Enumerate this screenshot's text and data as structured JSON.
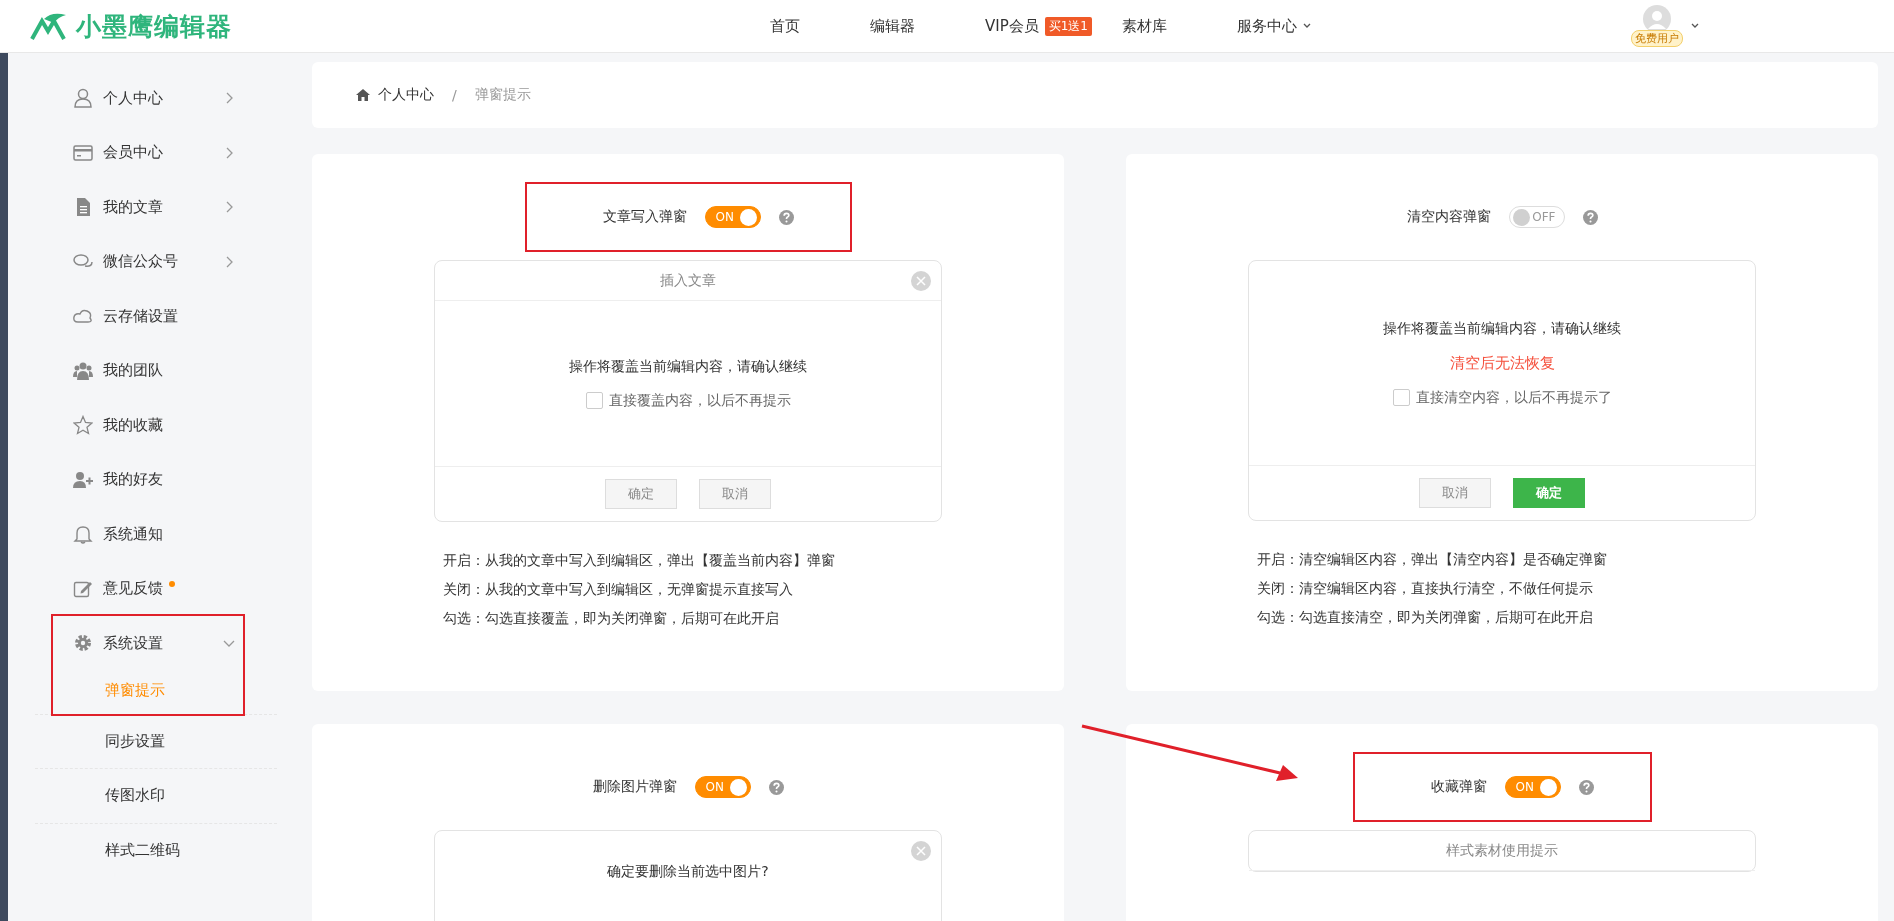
{
  "header": {
    "logo": "小墨鹰编辑器",
    "nav": [
      {
        "label": "首页",
        "dropdown": false
      },
      {
        "label": "编辑器",
        "dropdown": false
      },
      {
        "label": "VIP会员",
        "badge": "买1送1",
        "dropdown": false
      },
      {
        "label": "素材库",
        "dropdown": false
      },
      {
        "label": "服务中心",
        "dropdown": true
      }
    ],
    "user_badge": "免费用户"
  },
  "sidebar": {
    "items": [
      {
        "label": "个人中心",
        "kind": "group",
        "expanded": false,
        "unread": false,
        "highlighted": false
      },
      {
        "label": "会员中心",
        "kind": "group",
        "expanded": false,
        "unread": false,
        "highlighted": false
      },
      {
        "label": "我的文章",
        "kind": "group",
        "expanded": false,
        "unread": false,
        "highlighted": false
      },
      {
        "label": "微信公众号",
        "kind": "group",
        "expanded": false,
        "unread": false,
        "highlighted": false
      },
      {
        "label": "云存储设置",
        "kind": "link",
        "unread": false,
        "highlighted": false
      },
      {
        "label": "我的团队",
        "kind": "link",
        "unread": false,
        "highlighted": false
      },
      {
        "label": "我的收藏",
        "kind": "link",
        "unread": false,
        "highlighted": false
      },
      {
        "label": "我的好友",
        "kind": "link",
        "unread": false,
        "highlighted": false
      },
      {
        "label": "系统通知",
        "kind": "link",
        "unread": false,
        "highlighted": false
      },
      {
        "label": "意见反馈",
        "kind": "link",
        "unread": true,
        "highlighted": false
      },
      {
        "label": "系统设置",
        "kind": "group",
        "expanded": true,
        "unread": false,
        "highlighted": true,
        "children": [
          {
            "label": "弹窗提示",
            "selected": true
          },
          {
            "label": "同步设置",
            "selected": false
          },
          {
            "label": "传图水印",
            "selected": false
          },
          {
            "label": "样式二维码",
            "selected": false
          }
        ]
      }
    ]
  },
  "breadcrumb": {
    "separator": "/",
    "items": [
      "个人中心",
      "弹窗提示"
    ]
  },
  "cards": [
    {
      "title": "文章写入弹窗",
      "toggle_text": "ON",
      "on": true,
      "highlighted": true,
      "dialog": {
        "title": "插入文章",
        "closable": true,
        "message": "操作将覆盖当前编辑内容，请确认继续",
        "checkbox": {
          "label": "直接覆盖内容，以后不再提示",
          "checked": false
        },
        "buttons": [
          {
            "label": "确定",
            "primary": false
          },
          {
            "label": "取消",
            "primary": false
          }
        ]
      },
      "notes": [
        "开启：从我的文章中写入到编辑区，弹出【覆盖当前内容】弹窗",
        "关闭：从我的文章中写入到编辑区，无弹窗提示直接写入",
        "勾选：勾选直接覆盖，即为关闭弹窗，后期可在此开启"
      ]
    },
    {
      "title": "清空内容弹窗",
      "toggle_text": "OFF",
      "on": false,
      "highlighted": false,
      "dialog": {
        "closable": false,
        "message": "操作将覆盖当前编辑内容，请确认继续",
        "warning": "清空后无法恢复",
        "checkbox": {
          "label": "直接清空内容，以后不再提示了",
          "checked": false
        },
        "buttons": [
          {
            "label": "取消",
            "primary": false
          },
          {
            "label": "确定",
            "primary": true
          }
        ]
      },
      "notes": [
        "开启：清空编辑区内容，弹出【清空内容】是否确定弹窗",
        "关闭：清空编辑区内容，直接执行清空，不做任何提示",
        "勾选：勾选直接清空，即为关闭弹窗，后期可在此开启"
      ]
    },
    {
      "title": "删除图片弹窗",
      "toggle_text": "ON",
      "on": true,
      "highlighted": false,
      "dialog": {
        "closable": true,
        "message": "确定要删除当前选中图片?"
      }
    },
    {
      "title": "收藏弹窗",
      "toggle_text": "ON",
      "on": true,
      "highlighted": true,
      "dialog": {
        "title": "样式素材使用提示",
        "closable": false
      }
    }
  ]
}
